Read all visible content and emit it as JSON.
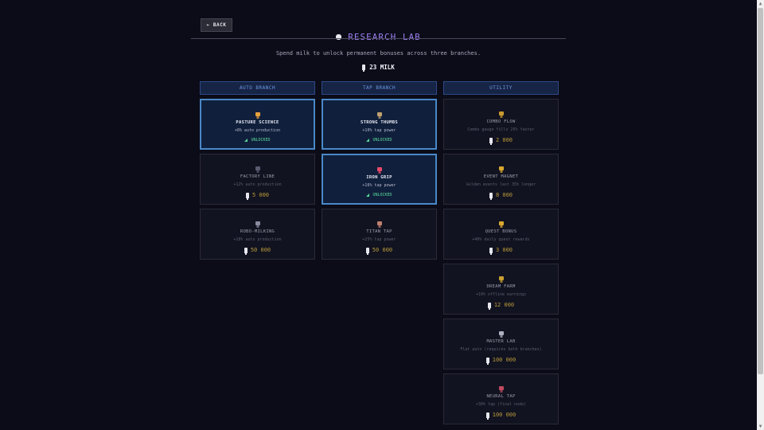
{
  "header": {
    "back_label": "← BACK",
    "title": "RESEARCH LAB",
    "subtitle": "Spend milk to unlock permanent bonuses across three branches.",
    "milk_amount": "23 MILK"
  },
  "columns": [
    {
      "name": "AUTO BRANCH",
      "cards": [
        {
          "name": "PASTURE SCIENCE",
          "desc": "+8% auto production",
          "status": "UNLOCKED",
          "icon": "barn-icon",
          "color": "#e8a040"
        },
        {
          "name": "FACTORY LINE",
          "desc": "+12% auto production",
          "cost": "5 000",
          "icon": "factory-icon",
          "color": "#5a5a70"
        },
        {
          "name": "ROBO-MILKING",
          "desc": "+18% auto production",
          "cost": "50 000",
          "icon": "robot-icon",
          "color": "#8a8aa0"
        }
      ]
    },
    {
      "name": "TAP BRANCH",
      "cards": [
        {
          "name": "STRONG THUMBS",
          "desc": "+10% tap power",
          "status": "UNLOCKED",
          "icon": "thumb-icon",
          "color": "#c0a070"
        },
        {
          "name": "IRON GRIP",
          "desc": "+16% tap power",
          "status": "UNLOCKED",
          "icon": "grip-icon",
          "color": "#e84a6a"
        },
        {
          "name": "TITAN TAP",
          "desc": "+25% tap power",
          "cost": "50 000",
          "icon": "titan-icon",
          "color": "#c08070"
        }
      ]
    },
    {
      "name": "UTILITY",
      "cards": [
        {
          "name": "COMBO FLOW",
          "desc": "Combo gauge fills 25% faster",
          "cost": "2 000",
          "icon": "hammer-icon",
          "color": "#c89a30"
        },
        {
          "name": "EVENT MAGNET",
          "desc": "Golden events last 35% longer",
          "cost": "8 000",
          "icon": "sparkle-icon",
          "color": "#d8a830"
        },
        {
          "name": "QUEST BONUS",
          "desc": "+40% daily quest rewards",
          "cost": "3 000",
          "icon": "star-icon",
          "color": "#d8a830"
        },
        {
          "name": "DREAM FARM",
          "desc": "+10% offline earnings",
          "cost": "12 000",
          "icon": "trophy-icon",
          "color": "#c8a030"
        },
        {
          "name": "MASTER LAB",
          "desc": "Flat auto (requires both branches)",
          "cost": "100 000",
          "icon": "flask-icon",
          "color": "#b0b0c0"
        },
        {
          "name": "NEURAL TAP",
          "desc": "+30% tap (final node)",
          "cost": "100 000",
          "icon": "brain-icon",
          "color": "#c04a60"
        }
      ]
    }
  ]
}
